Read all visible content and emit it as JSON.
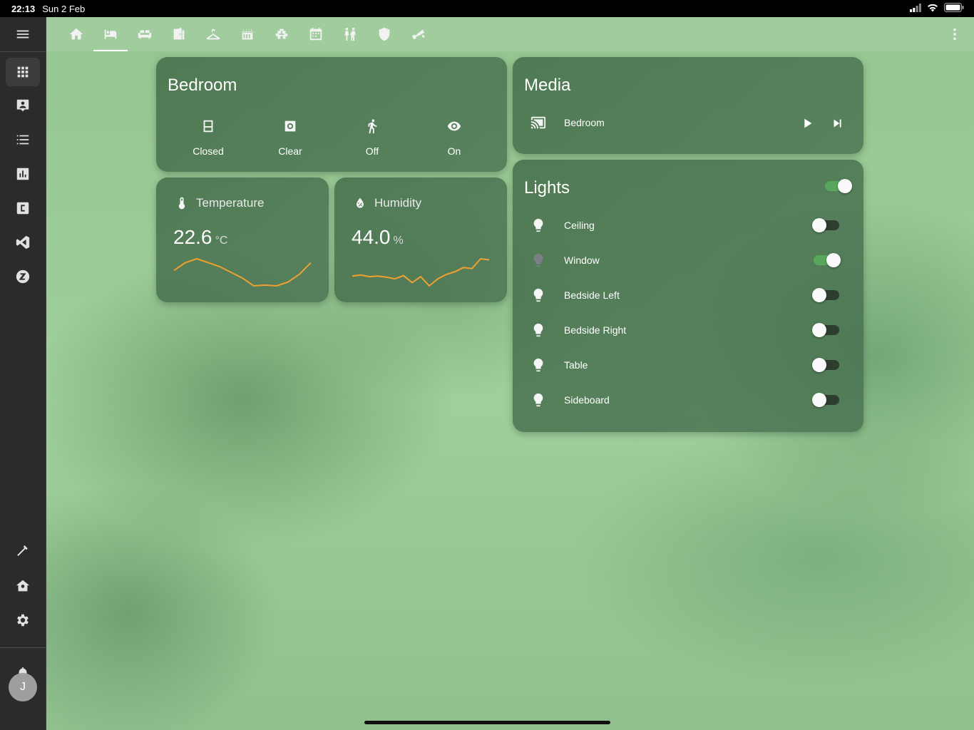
{
  "status": {
    "time": "22:13",
    "date": "Sun 2 Feb"
  },
  "sidebar": {
    "items": [
      {
        "icon": "menu-icon"
      },
      {
        "icon": "dashboard-grid-icon",
        "active": true
      },
      {
        "icon": "account-box-icon"
      },
      {
        "icon": "list-icon"
      },
      {
        "icon": "bar-chart-icon"
      },
      {
        "icon": "c-box-icon"
      },
      {
        "icon": "vscode-icon"
      },
      {
        "icon": "zwave-icon"
      },
      {
        "icon": "hammer-icon"
      },
      {
        "icon": "home-settings-icon"
      },
      {
        "icon": "gear-icon"
      },
      {
        "icon": "bell-icon"
      }
    ],
    "avatar_initial": "J"
  },
  "tabs": [
    {
      "icon": "home-icon"
    },
    {
      "icon": "bed-icon",
      "active": true
    },
    {
      "icon": "sofa-icon"
    },
    {
      "icon": "door-icon"
    },
    {
      "icon": "hanger-icon"
    },
    {
      "icon": "stove-icon"
    },
    {
      "icon": "stairs-icon"
    },
    {
      "icon": "calendar-icon"
    },
    {
      "icon": "people-icon"
    },
    {
      "icon": "shield-icon"
    },
    {
      "icon": "cctv-icon"
    }
  ],
  "bedroom": {
    "title": "Bedroom",
    "badges": [
      {
        "icon": "window-icon",
        "label": "Closed"
      },
      {
        "icon": "occupancy-icon",
        "label": "Clear"
      },
      {
        "icon": "walk-icon",
        "label": "Off"
      },
      {
        "icon": "eye-icon",
        "label": "On"
      }
    ]
  },
  "temperature": {
    "name": "Temperature",
    "value": "22.6",
    "unit": "°C",
    "history": [
      5,
      7,
      8,
      7,
      6,
      4.5,
      3,
      1,
      1.2,
      1,
      2,
      4,
      7
    ],
    "color": "#f0a030"
  },
  "humidity": {
    "name": "Humidity",
    "value": "44.0",
    "unit": "%",
    "history": [
      3,
      3.2,
      2.9,
      3,
      2.8,
      2.5,
      3.1,
      1.8,
      2.9,
      1.2,
      2.5,
      3.3,
      3.8,
      4.6,
      4.4,
      6.2,
      6
    ],
    "color": "#f0a030"
  },
  "media": {
    "title": "Media",
    "player": "Bedroom"
  },
  "lights": {
    "title": "Lights",
    "master_on": true,
    "items": [
      {
        "name": "Ceiling",
        "on": false,
        "icon_color": "#f5f5f5"
      },
      {
        "name": "Window",
        "on": true,
        "icon_color": "#7d7f88"
      },
      {
        "name": "Bedside Left",
        "on": false,
        "icon_color": "#f5f5f5"
      },
      {
        "name": "Bedside Right",
        "on": false,
        "icon_color": "#f5f5f5"
      },
      {
        "name": "Table",
        "on": false,
        "icon_color": "#f5f5f5"
      },
      {
        "name": "Sideboard",
        "on": false,
        "icon_color": "#f5f5f5"
      }
    ]
  }
}
